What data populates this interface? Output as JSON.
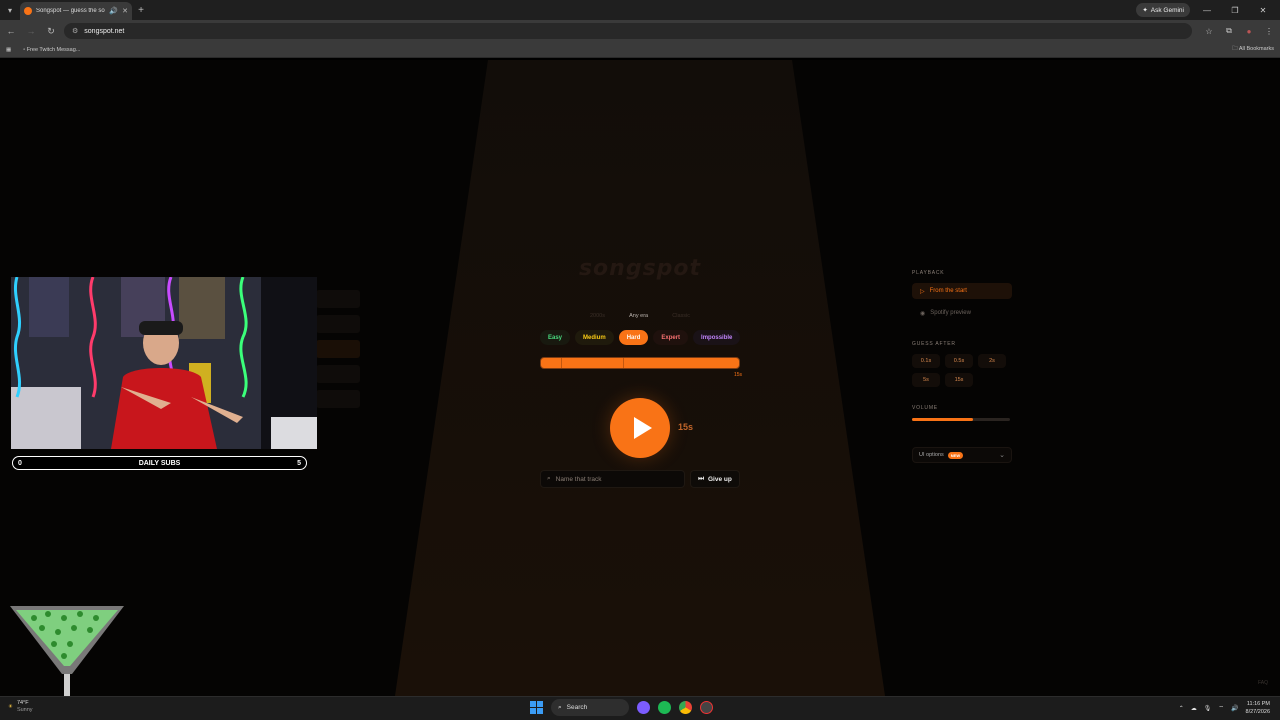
{
  "browser": {
    "tab_title": "Songspot — guess the song",
    "new_tab": "+",
    "gemini_label": "Ask Gemini",
    "url": "songspot.net",
    "bookmark_item": "Free Twitch Messag...",
    "all_bookmarks": "All Bookmarks"
  },
  "app": {
    "logo": "songspot",
    "eras": [
      "2000s",
      "Any era",
      "Classic"
    ],
    "selected_era": "Any era",
    "difficulties": [
      "Easy",
      "Medium",
      "Hard",
      "Expert",
      "Impossible"
    ],
    "selected_difficulty": "Hard",
    "progress_label": "15s",
    "progress_fraction": 1.0,
    "clip_duration": "15s",
    "search_placeholder": "Name that track",
    "give_up": "Give up",
    "faq": "FAQ"
  },
  "panel": {
    "playback_label": "PLAYBACK",
    "playback_options": [
      "From the start",
      "Spotify preview"
    ],
    "playback_selected": "From the start",
    "guess_after_label": "GUESS AFTER",
    "guess_after_options": [
      "0.1s",
      "0.5s",
      "2s",
      "5s",
      "15s"
    ],
    "volume_label": "VOLUME",
    "volume_fraction": 0.62,
    "ui_options_label": "UI options",
    "ui_options_badge": "NEW"
  },
  "overlay": {
    "subs_left": "0",
    "subs_title": "DAILY SUBS",
    "subs_right": "5"
  },
  "taskbar": {
    "temperature": "74°F",
    "weather_desc": "Sunny",
    "search_label": "Search",
    "time": "11:16 PM",
    "date": "8/27/2026"
  },
  "colors": {
    "accent": "#f97316",
    "easy": "#4ade80",
    "medium": "#facc15",
    "expert": "#f87171",
    "impossible": "#c084fc"
  }
}
